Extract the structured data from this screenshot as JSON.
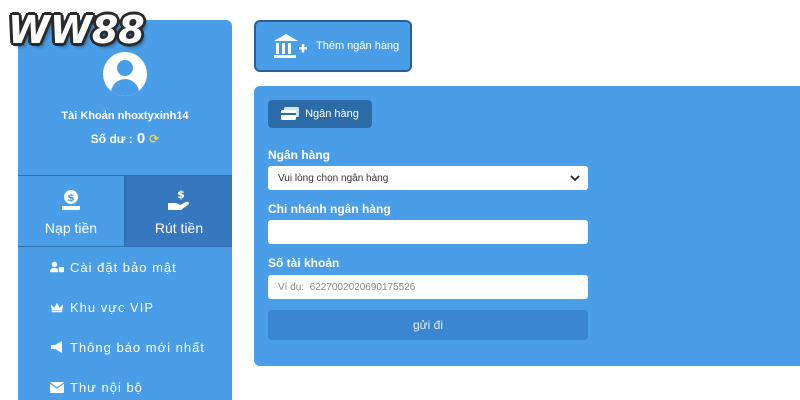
{
  "logo": {
    "text": "WW88"
  },
  "sidebar": {
    "account_label": "Tài Khoản nhoxtyxinh14",
    "balance_label": "Số dư :",
    "balance_value": "0",
    "actions": [
      {
        "label": "Nạp tiền",
        "icon": "money-bag-icon"
      },
      {
        "label": "Rút tiền",
        "icon": "hand-dollar-icon"
      }
    ],
    "menu": [
      {
        "label": "Cài đặt bảo mật",
        "icon": "user-lock-icon"
      },
      {
        "label": "Khu vực VIP",
        "icon": "crown-icon"
      },
      {
        "label": "Thông báo mới nhất",
        "icon": "megaphone-icon"
      },
      {
        "label": "Thư nội bộ",
        "icon": "envelope-icon"
      }
    ]
  },
  "add_bank": {
    "label": "Thêm ngân hàng",
    "icon": "bank-plus-icon"
  },
  "form": {
    "tab_label": "Ngân hàng",
    "bank_label": "Ngân hàng",
    "bank_select_value": "Vui lòng chọn ngân hàng",
    "branch_label": "Chi nhánh ngân hàng",
    "branch_value": "",
    "account_label": "Số tài khoản",
    "account_placeholder": "Ví dụ:  6227002020690175526",
    "submit_label": "gửi đi"
  },
  "colors": {
    "primary": "#4a9ee8",
    "dark": "#2d6aa8",
    "accent": "#f7d03a"
  }
}
